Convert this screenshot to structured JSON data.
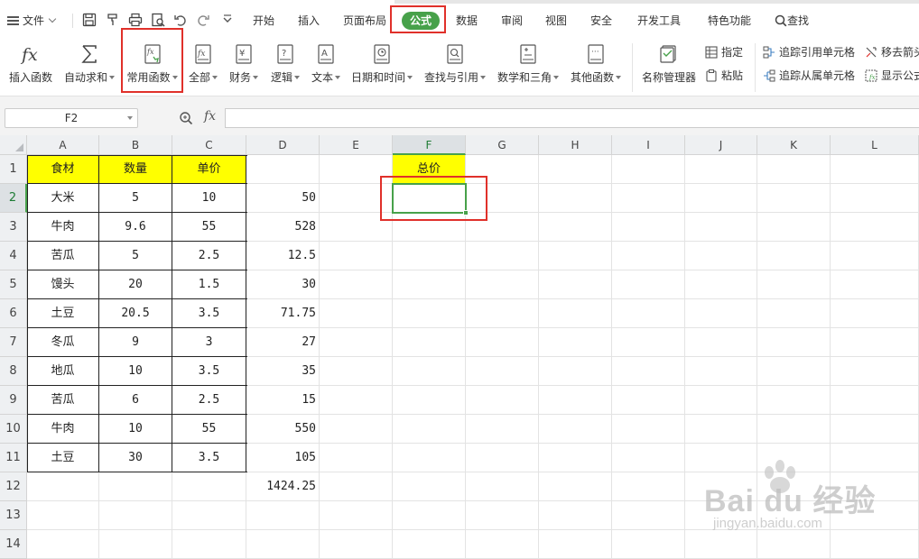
{
  "menu": {
    "file_label": "文件",
    "tabs": [
      "开始",
      "插入",
      "页面布局",
      "公式",
      "数据",
      "审阅",
      "视图",
      "安全",
      "开发工具",
      "特色功能"
    ],
    "active_tab": "公式",
    "search_label": "查找"
  },
  "ribbon": {
    "insert_function": "插入函数",
    "autosum": "自动求和",
    "common_functions": "常用函数",
    "all": "全部",
    "finance": "财务",
    "logic": "逻辑",
    "text": "文本",
    "datetime": "日期和时间",
    "lookup": "查找与引用",
    "math": "数学和三角",
    "other": "其他函数",
    "name_manager": "名称管理器",
    "assign": "指定",
    "paste": "粘贴",
    "trace_precedents": "追踪引用单元格",
    "trace_dependents": "追踪从属单元格",
    "remove_arrows": "移去箭头",
    "show_formulas": "显示公式"
  },
  "formula_bar": {
    "name_box": "F2",
    "fx": "fx",
    "formula": ""
  },
  "sheet": {
    "columns": [
      "A",
      "B",
      "C",
      "D",
      "E",
      "F",
      "G",
      "H",
      "I",
      "J",
      "K",
      "L"
    ],
    "selected_column": "F",
    "selected_row": 2,
    "rows": [
      1,
      2,
      3,
      4,
      5,
      6,
      7,
      8,
      9,
      10,
      11,
      12,
      13,
      14
    ],
    "headers": {
      "a": "食材",
      "b": "数量",
      "c": "单价",
      "f": "总价"
    },
    "data": [
      {
        "food": "大米",
        "qty": "5",
        "price": "10",
        "total": "50"
      },
      {
        "food": "牛肉",
        "qty": "9.6",
        "price": "55",
        "total": "528"
      },
      {
        "food": "苦瓜",
        "qty": "5",
        "price": "2.5",
        "total": "12.5"
      },
      {
        "food": "馒头",
        "qty": "20",
        "price": "1.5",
        "total": "30"
      },
      {
        "food": "土豆",
        "qty": "20.5",
        "price": "3.5",
        "total": "71.75"
      },
      {
        "food": "冬瓜",
        "qty": "9",
        "price": "3",
        "total": "27"
      },
      {
        "food": "地瓜",
        "qty": "10",
        "price": "3.5",
        "total": "35"
      },
      {
        "food": "苦瓜",
        "qty": "6",
        "price": "2.5",
        "total": "15"
      },
      {
        "food": "牛肉",
        "qty": "10",
        "price": "55",
        "total": "550"
      },
      {
        "food": "土豆",
        "qty": "30",
        "price": "3.5",
        "total": "105"
      }
    ],
    "grand_total": "1424.25"
  },
  "watermark": {
    "brand": "Bai du 经验",
    "url": "jingyan.baidu.com"
  },
  "colors": {
    "accent_green": "#47a14a",
    "header_yellow": "#ffff00",
    "highlight_red": "#e0302a"
  }
}
